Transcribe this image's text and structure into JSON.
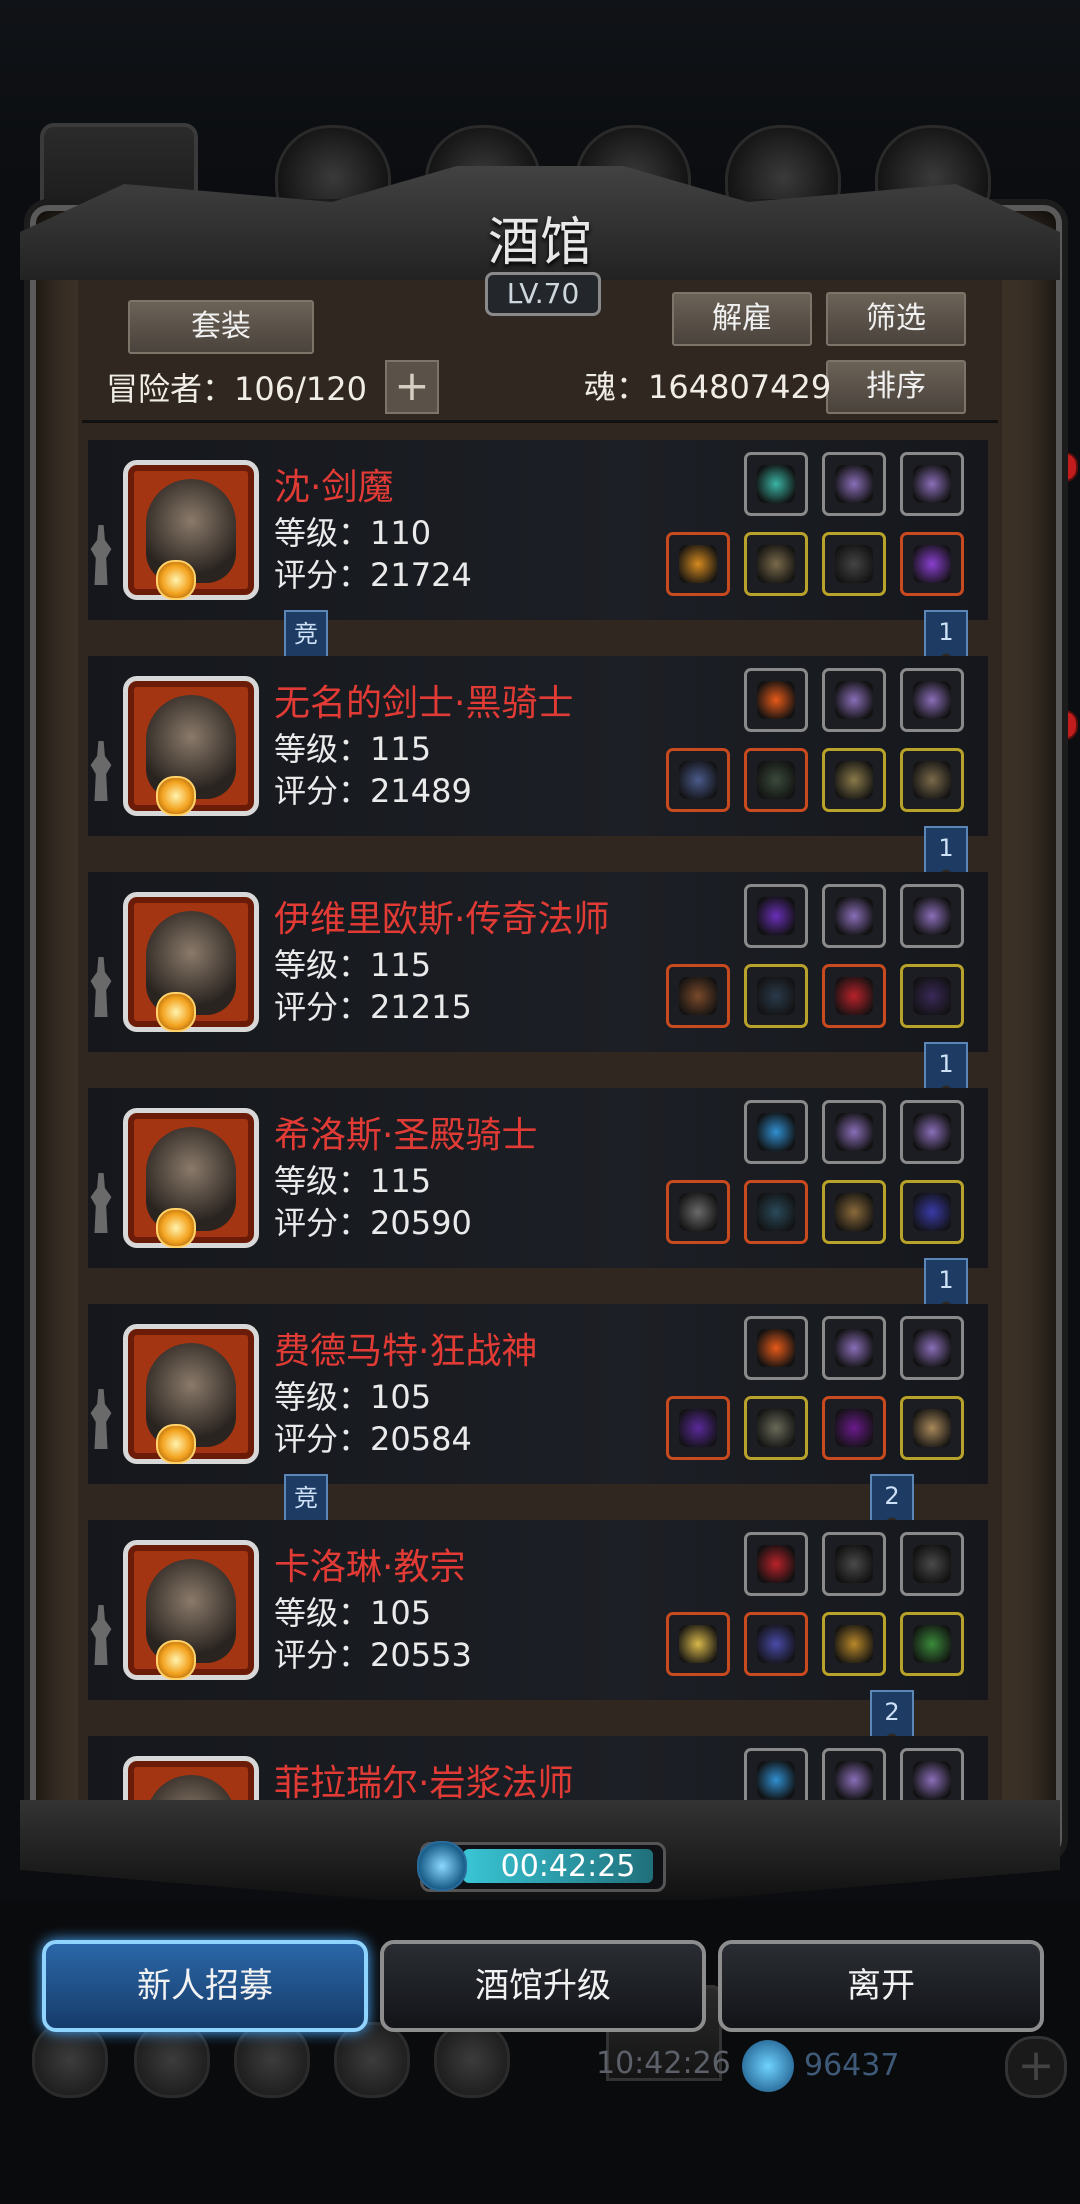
{
  "header": {
    "title": "酒馆",
    "level": "LV.70"
  },
  "toolbar": {
    "set_label": "套装",
    "dismiss_label": "解雇",
    "filter_label": "筛选",
    "sort_label": "排序",
    "plus_label": "+",
    "adventurer_label": "冒险者：106/120",
    "soul_label": "魂：164807429"
  },
  "heroes": [
    {
      "name": "沈·剑魔",
      "level": "等级：110",
      "score": "评分：21724",
      "tag": "竞",
      "rank": "1",
      "top_slots": [
        "#3ab3a3",
        "#8a6fb8",
        "#8a6fb8"
      ],
      "bottom_slots": [
        "#d48a1f",
        "#7a6a4a",
        "#444444",
        "#8a3fd1"
      ],
      "bottom_borders": [
        "#c84a1e",
        "#b9a22a",
        "#b9a22a",
        "#c84a1e"
      ]
    },
    {
      "name": "无名的剑士·黑骑士",
      "level": "等级：115",
      "score": "评分：21489",
      "tag": "",
      "rank": "1",
      "top_slots": [
        "#e85a1a",
        "#8a6fb8",
        "#8a6fb8"
      ],
      "bottom_slots": [
        "#4a5a8a",
        "#3a4a3a",
        "#8a7a4a",
        "#7a6a4a"
      ],
      "bottom_borders": [
        "#c84a1e",
        "#c84a1e",
        "#b9a22a",
        "#b9a22a"
      ]
    },
    {
      "name": "伊维里欧斯·传奇法师",
      "level": "等级：115",
      "score": "评分：21215",
      "tag": "",
      "rank": "1",
      "top_slots": [
        "#6a2fb8",
        "#8a6fb8",
        "#8a6fb8"
      ],
      "bottom_slots": [
        "#7a4a2a",
        "#2a3a4a",
        "#b8222a",
        "#3a2a5a"
      ],
      "bottom_borders": [
        "#c84a1e",
        "#b9a22a",
        "#c84a1e",
        "#b9a22a"
      ]
    },
    {
      "name": "希洛斯·圣殿骑士",
      "level": "等级：115",
      "score": "评分：20590",
      "tag": "",
      "rank": "1",
      "top_slots": [
        "#2f8fd1",
        "#8a6fb8",
        "#8a6fb8"
      ],
      "bottom_slots": [
        "#6a6a6a",
        "#2a4a5a",
        "#8a6a3a",
        "#3a3aa8"
      ],
      "bottom_borders": [
        "#c84a1e",
        "#c84a1e",
        "#b9a22a",
        "#b9a22a"
      ]
    },
    {
      "name": "费德马特·狂战神",
      "level": "等级：105",
      "score": "评分：20584",
      "tag": "竞",
      "rank": "2",
      "top_slots": [
        "#e85a1a",
        "#8a6fb8",
        "#8a6fb8"
      ],
      "bottom_slots": [
        "#5a2a9a",
        "#6a6a5a",
        "#6a1a8a",
        "#a8885a"
      ],
      "bottom_borders": [
        "#c84a1e",
        "#b9a22a",
        "#c84a1e",
        "#b9a22a"
      ]
    },
    {
      "name": "卡洛琳·教宗",
      "level": "等级：105",
      "score": "评分：20553",
      "tag": "",
      "rank": "2",
      "top_slots": [
        "#b8222a",
        "#4a4a4a",
        "#4a4a4a"
      ],
      "bottom_slots": [
        "#d8b84a",
        "#4a4aa8",
        "#b8882a",
        "#3a8a3a"
      ],
      "bottom_borders": [
        "#c84a1e",
        "#c84a1e",
        "#b9a22a",
        "#b9a22a"
      ]
    },
    {
      "name": "菲拉瑞尔·岩浆法师",
      "level": "",
      "score": "",
      "tag": "",
      "rank": "",
      "top_slots": [
        "#2f8fd1",
        "#8a6fb8",
        "#8a6fb8"
      ],
      "bottom_slots": [],
      "bottom_borders": []
    }
  ],
  "timer": "00:42:25",
  "buttons": {
    "recruit": "新人招募",
    "upgrade": "酒馆升级",
    "leave": "离开"
  },
  "background": {
    "clock": "10:42:26",
    "gems": "96437",
    "plus": "+"
  },
  "colors": {
    "hero_name": "#e23b35",
    "accent_blue": "#8fd3ff"
  }
}
